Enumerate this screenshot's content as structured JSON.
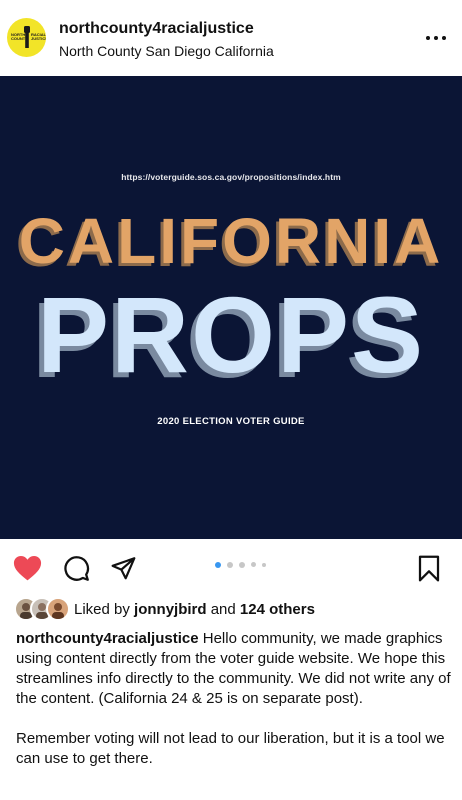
{
  "header": {
    "username": "northcounty4racialjustice",
    "location": "North County San Diego California",
    "avatar_text_left": "NORTH COUNTY",
    "avatar_text_right": "RACIAL JUSTICE",
    "more_icon": "more-horizontal-icon"
  },
  "post": {
    "url": "https://voterguide.sos.ca.gov/propositions/index.htm",
    "title_line1": "CALIFORNIA",
    "title_line2": "PROPS",
    "subtitle": "2020 ELECTION VOTER GUIDE",
    "colors": {
      "background": "#0b1535",
      "title1": "#e2a467",
      "title2": "#d3e7fb"
    }
  },
  "actions": {
    "like_icon": "heart-filled-icon",
    "comment_icon": "comment-icon",
    "share_icon": "paper-plane-icon",
    "save_icon": "bookmark-icon",
    "carousel": {
      "count": 5,
      "active": 0
    },
    "liked_color": "#ed4956"
  },
  "likes": {
    "prefix": "Liked by",
    "user": "jonnyjbird",
    "conj": "and",
    "others": "124 others"
  },
  "caption": {
    "username": "northcounty4racialjustice",
    "text": " Hello community, we made graphics using content directly from the voter guide website. We hope this streamlines info directly to the community. We did not write any of the content. (California 24 & 25 is on separate post).",
    "text2": "Remember voting will not lead to our liberation, but it is a tool we can use to get there."
  }
}
